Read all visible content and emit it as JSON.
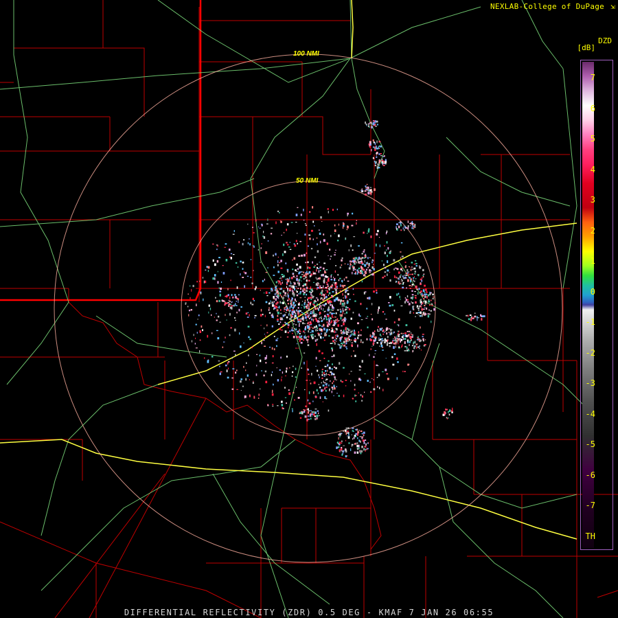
{
  "credit": {
    "text": "NEXLAB-College of DuPage",
    "ext_icon": "external-link-icon"
  },
  "product": {
    "code": "DZD",
    "unit": "[dB]",
    "title": "DIFFERENTIAL REFLECTIVITY (ZDR) 0.5 DEG - KMAF 7 JAN 26 06:55"
  },
  "rings": {
    "inner": "50 NMI",
    "outer": "100 NMI"
  },
  "legend": {
    "ticks": [
      "7",
      "6",
      "5",
      "4",
      "3",
      "2",
      "1",
      "0",
      "-1",
      "-2",
      "-3",
      "-4",
      "-5",
      "-6",
      "-7",
      "TH"
    ],
    "range_db": [
      -7.5,
      7.5
    ]
  },
  "colors": {
    "label": "#ffff00",
    "county_lines": "#c00000",
    "state_line": "#ff0000",
    "highways": "#7ee07e",
    "interstates": "#ffff40",
    "range_rings": "#ffb0a0"
  }
}
